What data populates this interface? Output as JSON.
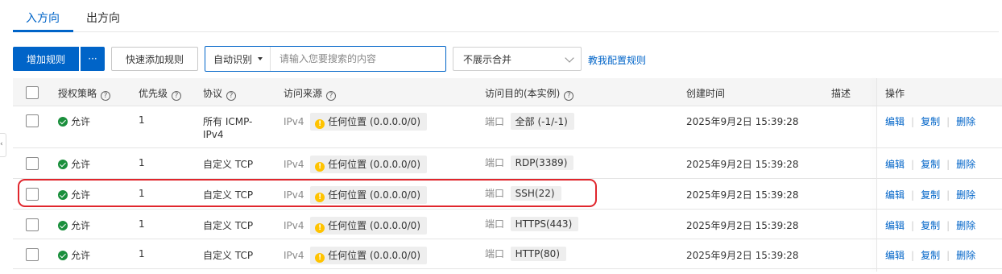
{
  "tabs": [
    {
      "label": "入方向",
      "active": true
    },
    {
      "label": "出方向",
      "active": false
    }
  ],
  "toolbar": {
    "add_rule": "增加规则",
    "more": "···",
    "quick_add": "快速添加规则",
    "search_type": "自动识别",
    "search_placeholder": "请输入您要搜索的内容",
    "merge_select": "不展示合并",
    "help_link": "教我配置规则"
  },
  "table": {
    "headers": {
      "policy": "授权策略",
      "priority": "优先级",
      "protocol": "协议",
      "source": "访问来源",
      "destination": "访问目的(本实例)",
      "created": "创建时间",
      "description": "描述",
      "actions": "操作"
    },
    "rows": [
      {
        "policy": "允许",
        "priority": "1",
        "protocol_line1": "所有 ICMP-",
        "protocol_line2": "IPv4",
        "ip_type": "IPv4",
        "source": "任何位置 (0.0.0.0/0)",
        "port_label": "端口",
        "port": "全部 (-1/-1)",
        "created": "2025年9月2日 15:39:28"
      },
      {
        "policy": "允许",
        "priority": "1",
        "protocol": "自定义 TCP",
        "ip_type": "IPv4",
        "source": "任何位置 (0.0.0.0/0)",
        "port_label": "端口",
        "port": "RDP(3389)",
        "created": "2025年9月2日 15:39:28"
      },
      {
        "policy": "允许",
        "priority": "1",
        "protocol": "自定义 TCP",
        "ip_type": "IPv4",
        "source": "任何位置 (0.0.0.0/0)",
        "port_label": "端口",
        "port": "SSH(22)",
        "created": "2025年9月2日 15:39:28"
      },
      {
        "policy": "允许",
        "priority": "1",
        "protocol": "自定义 TCP",
        "ip_type": "IPv4",
        "source": "任何位置 (0.0.0.0/0)",
        "port_label": "端口",
        "port": "HTTPS(443)",
        "created": "2025年9月2日 15:39:28"
      },
      {
        "policy": "允许",
        "priority": "1",
        "protocol": "自定义 TCP",
        "ip_type": "IPv4",
        "source": "任何位置 (0.0.0.0/0)",
        "port_label": "端口",
        "port": "HTTP(80)",
        "created": "2025年9月2日 15:39:28"
      }
    ],
    "actions": {
      "edit": "编辑",
      "copy": "复制",
      "delete": "删除"
    }
  },
  "edge_toggle": "‹",
  "colors": {
    "accent": "#0064c8",
    "highlight": "#e0262d",
    "success": "#1a8f3c",
    "warning": "#ffc300"
  }
}
